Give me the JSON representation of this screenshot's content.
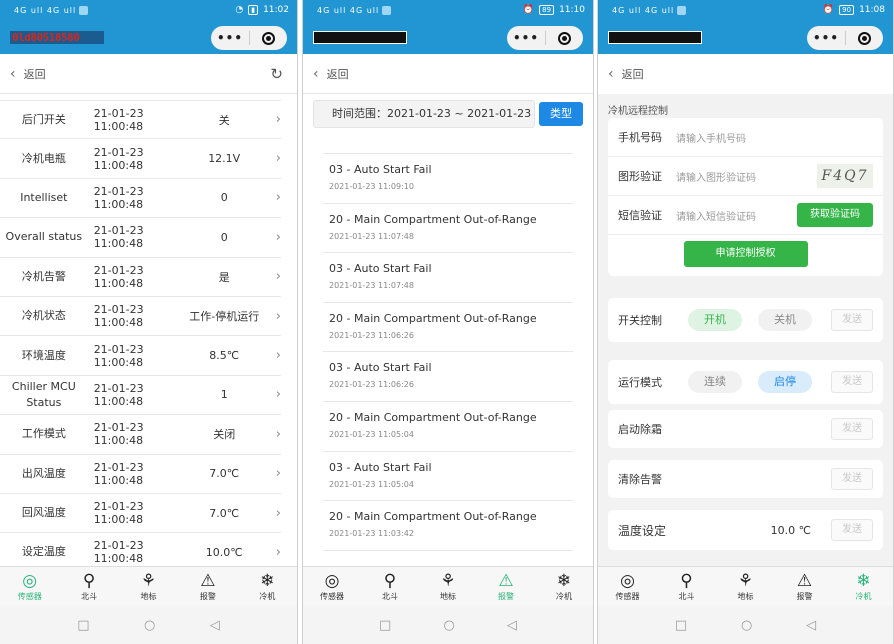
{
  "common": {
    "status_sig": "4G ull 4G ull",
    "back_label": "返回",
    "tabs": [
      {
        "label": "传感器",
        "icon": "sensor-icon"
      },
      {
        "label": "北斗",
        "icon": "location-pin-icon"
      },
      {
        "label": "地标",
        "icon": "landmark-icon"
      },
      {
        "label": "报警",
        "icon": "alarm-icon"
      },
      {
        "label": "冷机",
        "icon": "snowflake-icon"
      }
    ]
  },
  "panel1": {
    "time": "11:02",
    "title": "0ld80518580",
    "rows": [
      {
        "name": "后门开关",
        "time": "21-01-23 11:00:48",
        "value": "关"
      },
      {
        "name": "冷机电瓶",
        "time": "21-01-23 11:00:48",
        "value": "12.1V"
      },
      {
        "name": "Intelliset",
        "time": "21-01-23 11:00:48",
        "value": "0"
      },
      {
        "name": "Overall status",
        "time": "21-01-23 11:00:48",
        "value": "0"
      },
      {
        "name": "冷机告警",
        "time": "21-01-23 11:00:48",
        "value": "是"
      },
      {
        "name": "冷机状态",
        "time": "21-01-23 11:00:48",
        "value": "工作-停机运行"
      },
      {
        "name": "环境温度",
        "time": "21-01-23 11:00:48",
        "value": "8.5℃"
      },
      {
        "name": "Chiller MCU Status",
        "time": "21-01-23 11:00:48",
        "value": "1"
      },
      {
        "name": "工作模式",
        "time": "21-01-23 11:00:48",
        "value": "关闭"
      },
      {
        "name": "出风温度",
        "time": "21-01-23 11:00:48",
        "value": "7.0℃"
      },
      {
        "name": "回风温度",
        "time": "21-01-23 11:00:48",
        "value": "7.0℃"
      },
      {
        "name": "设定温度",
        "time": "21-01-23 11:00:48",
        "value": "10.0℃"
      }
    ]
  },
  "panel2": {
    "time": "11:10",
    "battery": "89",
    "range_label": "时间范围：2021-01-23 ~ 2021-01-23",
    "type_button": "类型",
    "alarms": [
      {
        "title": "03 - Auto Start Fail",
        "time": "2021-01-23 11:09:10"
      },
      {
        "title": "20 - Main Compartment Out-of-Range",
        "time": "2021-01-23 11:07:48"
      },
      {
        "title": "03 - Auto Start Fail",
        "time": "2021-01-23 11:07:48"
      },
      {
        "title": "20 - Main Compartment Out-of-Range",
        "time": "2021-01-23 11:06:26"
      },
      {
        "title": "03 - Auto Start Fail",
        "time": "2021-01-23 11:06:26"
      },
      {
        "title": "20 - Main Compartment Out-of-Range",
        "time": "2021-01-23 11:05:04"
      },
      {
        "title": "03 - Auto Start Fail",
        "time": "2021-01-23 11:05:04"
      },
      {
        "title": "20 - Main Compartment Out-of-Range",
        "time": "2021-01-23 11:03:42"
      }
    ]
  },
  "panel3": {
    "time": "11:08",
    "battery": "90",
    "section_title": "冷机远程控制",
    "phone_label": "手机号码",
    "phone_placeholder": "请输入手机号码",
    "captcha_label": "图形验证",
    "captcha_placeholder": "请输入图形验证码",
    "captcha_text": "F4Q7",
    "sms_label": "短信验证",
    "sms_placeholder": "请输入短信验证码",
    "get_code": "获取验证码",
    "apply": "申请控制授权",
    "switch_label": "开关控制",
    "on": "开机",
    "off": "关机",
    "send": "发送",
    "mode_label": "运行模式",
    "continuous": "连续",
    "start_stop": "启停",
    "defrost": "启动除霜",
    "clear_alarm": "清除告警",
    "temp_label": "温度设定",
    "temp_value": "10.0 ℃"
  }
}
